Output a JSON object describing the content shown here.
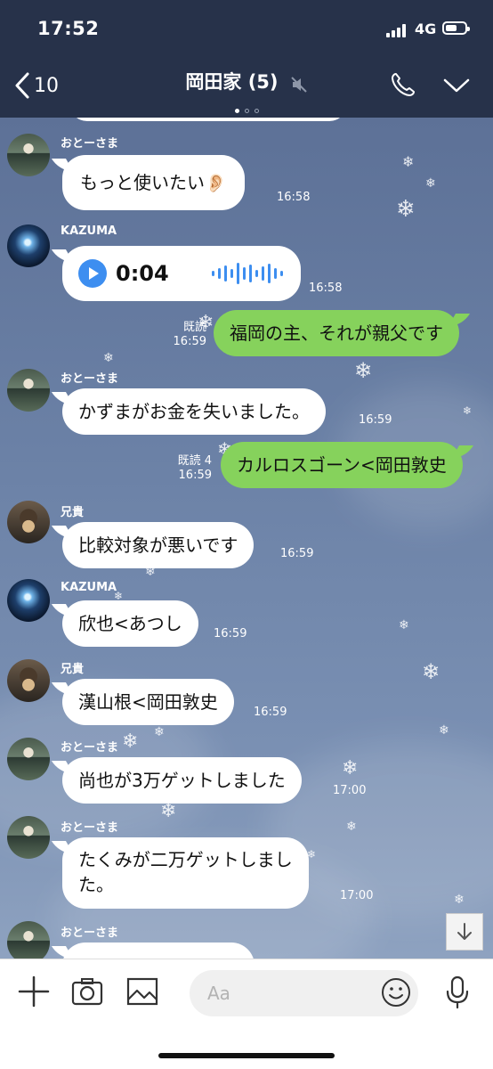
{
  "status_bar": {
    "time": "17:52",
    "network": "4G"
  },
  "header": {
    "back_count": "10",
    "title": "岡田家 (5)"
  },
  "messages": {
    "m1": {
      "sender": "おとーさま",
      "text": "もっと使いたい👂🏻",
      "time": "16:58"
    },
    "m2": {
      "sender": "KAZUMA",
      "duration": "0:04",
      "time": "16:58"
    },
    "m3": {
      "read": "既読",
      "text": "福岡の主、それが親父です",
      "time": "16:59"
    },
    "m4": {
      "sender": "おとーさま",
      "text": "かずまがお金を失いました。",
      "time": "16:59"
    },
    "m5": {
      "read": "既読 4",
      "text": "カルロスゴーン<岡田敦史",
      "time": "16:59"
    },
    "m6": {
      "sender": "兄貴",
      "text": "比較対象が悪いです",
      "time": "16:59"
    },
    "m7": {
      "sender": "KAZUMA",
      "text": "欣也<あつし",
      "time": "16:59"
    },
    "m8": {
      "sender": "兄貴",
      "text": "漢山根<岡田敦史",
      "time": "16:59"
    },
    "m9": {
      "sender": "おとーさま",
      "text": "尚也が3万ゲットしました",
      "time": "17:00"
    },
    "m10": {
      "sender": "おとーさま",
      "line1": "たくみが二万ゲットしまし",
      "line2": "た。",
      "time": "17:00"
    },
    "m11": {
      "sender": "おとーさま"
    }
  },
  "input": {
    "placeholder": "Aa"
  },
  "colors": {
    "header_bg": "#27324a",
    "outgoing_bubble": "#86d25c",
    "voice_accent": "#3d8ef0"
  }
}
